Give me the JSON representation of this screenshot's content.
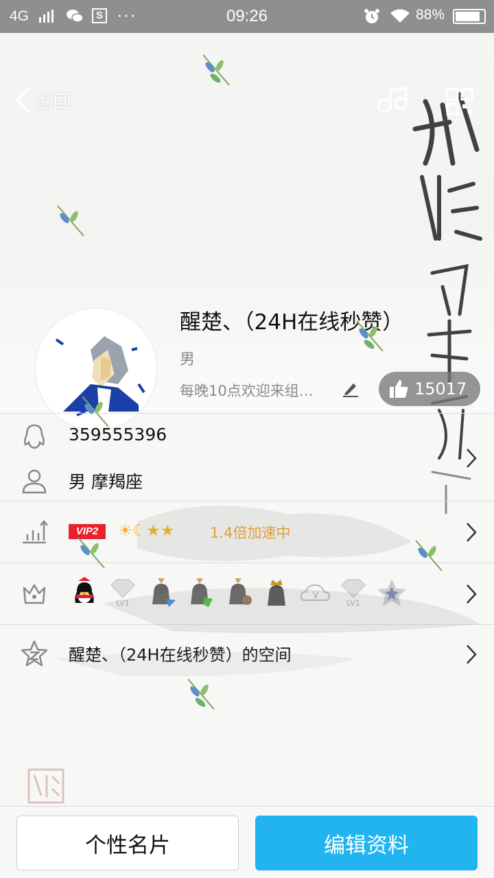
{
  "status_bar": {
    "network": "4G",
    "time": "09:26",
    "battery_percent": "88%",
    "battery_level": 0.88
  },
  "header": {
    "back_label": "返回",
    "nickname": "醒楚、（24H在线秒赞）",
    "gender": "男",
    "signature": "每晚10点欢迎来组…",
    "likes": "15017"
  },
  "info": {
    "qq_number": "359555396",
    "gender_zodiac": "男  摩羯座",
    "vip_badge": "VIP2",
    "speed_text": "1.4倍加速中",
    "space_title": "醒楚、（24H在线秒赞）的空间",
    "badge_labels": [
      "LV1",
      "LV1"
    ]
  },
  "bottom": {
    "card_button": "个性名片",
    "edit_button": "编辑资料"
  },
  "colors": {
    "accent": "#21b4f0",
    "vip_red": "#e8212c",
    "speed_orange": "#f0a020"
  }
}
